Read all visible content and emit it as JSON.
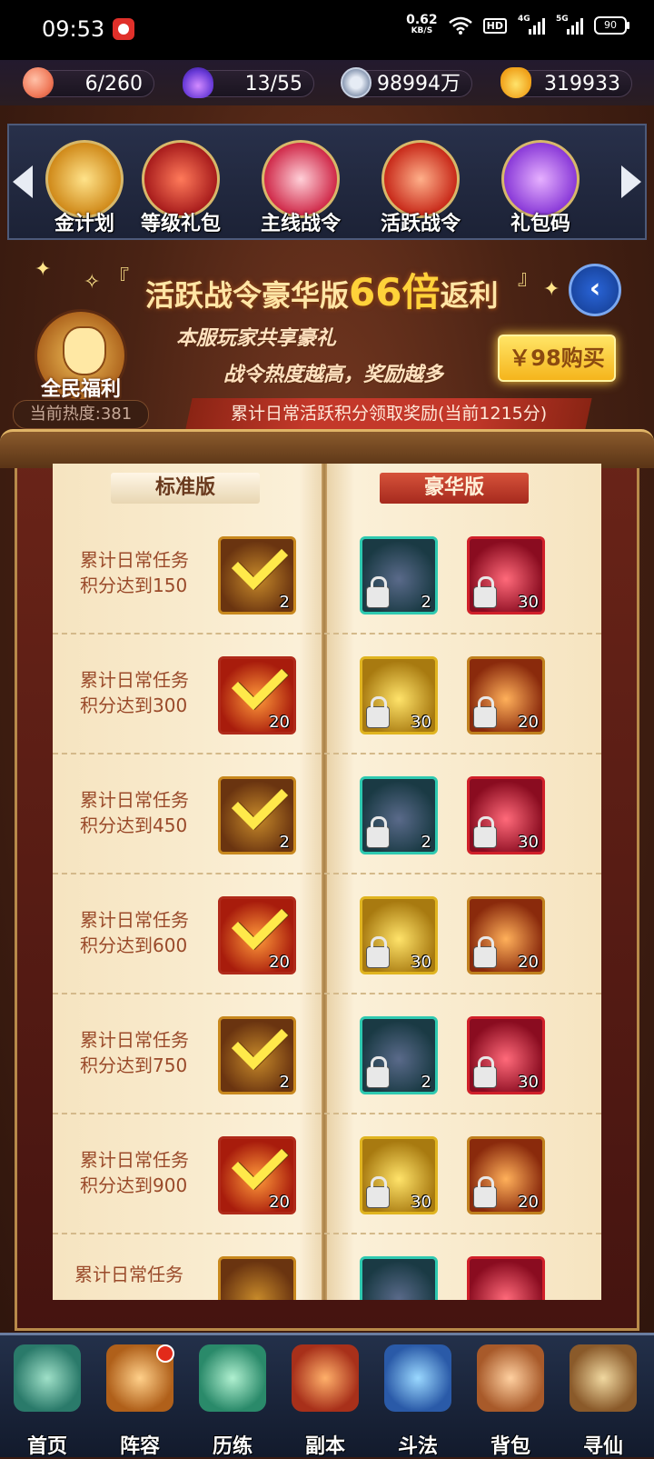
{
  "status_bar": {
    "time": "09:53",
    "net_speed": "0.62",
    "net_unit": "KB/S",
    "hd": "HD",
    "sig1": "4G",
    "sig2": "5G",
    "battery": "90"
  },
  "resources": [
    {
      "icon": "peach-icon",
      "value": "6/260"
    },
    {
      "icon": "flame-icon",
      "value": "13/55"
    },
    {
      "icon": "coin-icon",
      "value": "98994万"
    },
    {
      "icon": "gold-ingot-icon",
      "value": "319933"
    }
  ],
  "features": [
    {
      "label": "金计划",
      "icon": "gold-plan-icon"
    },
    {
      "label": "等级礼包",
      "icon": "level-gift-icon"
    },
    {
      "label": "主线战令",
      "icon": "main-pass-icon"
    },
    {
      "label": "活跃战令",
      "icon": "active-pass-icon"
    },
    {
      "label": "礼包码",
      "icon": "gift-code-icon"
    }
  ],
  "banner": {
    "title_pre": "活跃战令豪华版",
    "title_big": "66倍",
    "title_post": "返利"
  },
  "welfare": {
    "label": "全民福利",
    "heat": "当前热度:381"
  },
  "slogans": {
    "line1": "本服玩家共享豪礼",
    "line2": "战令热度越高，奖励越多"
  },
  "buy_label": "￥98购买",
  "notice": "累计日常活跃积分领取奖励(当前1215分)",
  "tabs": {
    "standard": "标准版",
    "deluxe": "豪华版"
  },
  "rows": [
    {
      "line1": "累计日常任务",
      "line2": "积分达到150"
    },
    {
      "line1": "累计日常任务",
      "line2": "积分达到300"
    },
    {
      "line1": "累计日常任务",
      "line2": "积分达到450"
    },
    {
      "line1": "累计日常任务",
      "line2": "积分达到600"
    },
    {
      "line1": "累计日常任务",
      "line2": "积分达到750"
    },
    {
      "line1": "累计日常任务",
      "line2": "积分达到900"
    },
    {
      "line1": "累计日常任务",
      "line2": ""
    }
  ],
  "item_counts": {
    "chest": "2",
    "fire": "20",
    "jade": "2",
    "red": "30",
    "gold": "30",
    "ember": "20"
  },
  "nav": [
    {
      "label": "首页",
      "icon": "home-icon"
    },
    {
      "label": "阵容",
      "icon": "lineup-icon"
    },
    {
      "label": "历练",
      "icon": "training-icon"
    },
    {
      "label": "副本",
      "icon": "dungeon-icon"
    },
    {
      "label": "斗法",
      "icon": "battle-icon"
    },
    {
      "label": "背包",
      "icon": "backpack-icon"
    },
    {
      "label": "寻仙",
      "icon": "seek-immortal-icon"
    }
  ]
}
